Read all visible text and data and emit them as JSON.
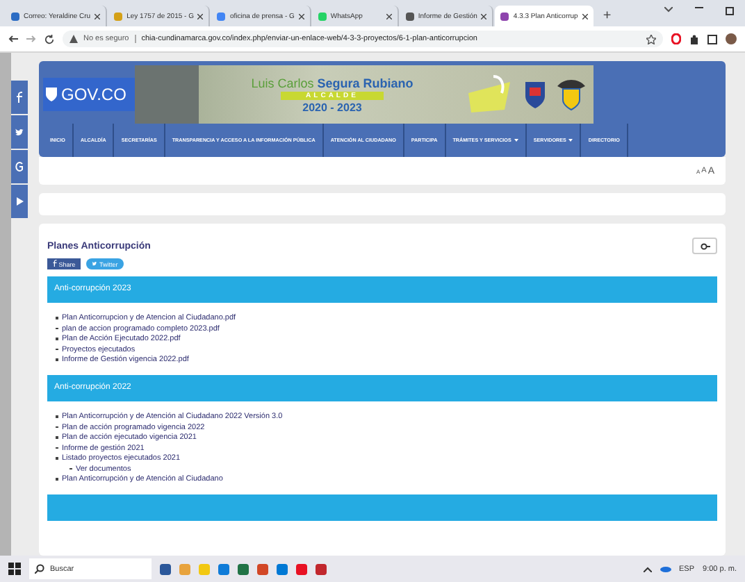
{
  "browser": {
    "tabs": [
      {
        "label": "Correo: Yeraldine Cru",
        "selected": false,
        "color": "#2b6cc4"
      },
      {
        "label": "Ley 1757 de 2015 - G",
        "selected": false,
        "color": "#d4a017"
      },
      {
        "label": "oficina de prensa - G",
        "selected": false,
        "color": "#4285f4"
      },
      {
        "label": "WhatsApp",
        "selected": false,
        "color": "#25d366"
      },
      {
        "label": "Informe de Gestión",
        "selected": false,
        "color": "#555555"
      },
      {
        "label": "4.3.3 Plan Anticorrup",
        "selected": true,
        "color": "#8e44ad"
      }
    ],
    "new_tab": "+",
    "security": "No es seguro",
    "url": "chia-cundinamarca.gov.co/index.php/enviar-un-enlace-web/4-3-3-proyectos/6-1-plan-anticorrupcion"
  },
  "header": {
    "logo": "GOV.CO",
    "banner": {
      "first_name": "Luis Carlos",
      "last_name": "Segura Rubiano",
      "role": "ALCALDE",
      "years": "2020 - 2023"
    },
    "nav": [
      {
        "label": "INICIO",
        "dropdown": false
      },
      {
        "label": "ALCALDÍA",
        "dropdown": false
      },
      {
        "label": "SECRETARÍAS",
        "dropdown": false
      },
      {
        "label": "TRANSPARENCIA Y ACCESO A LA INFORMACIÓN PÚBLICA",
        "dropdown": false
      },
      {
        "label": "ATENCIÓN AL CIUDADANO",
        "dropdown": false
      },
      {
        "label": "PARTICIPA",
        "dropdown": false
      },
      {
        "label": "TRÁMITES Y SERVICIOS",
        "dropdown": true
      },
      {
        "label": "SERVIDORES",
        "dropdown": true
      },
      {
        "label": "DIRECTORIO",
        "dropdown": false
      }
    ]
  },
  "font_sizes": [
    "A",
    "A",
    "A"
  ],
  "content": {
    "title": "Planes Anticorrupción",
    "share": [
      {
        "kind": "facebook",
        "label": "Share"
      },
      {
        "kind": "twitter",
        "label": "Twitter"
      }
    ],
    "sections": [
      {
        "title": "Anti-corrupción 2023",
        "items": [
          {
            "text": "Plan Anticorrupcion y de Atencion al Ciudadano.pdf"
          },
          {
            "text": "plan de accion programado completo 2023.pdf"
          },
          {
            "text": "Plan de Acción Ejecutado 2022.pdf"
          },
          {
            "text": "Proyectos ejecutados"
          },
          {
            "text": "Informe de Gestión vigencia 2022.pdf"
          }
        ]
      },
      {
        "title": "Anti-corrupción 2022",
        "items": [
          {
            "text": "Plan Anticorrupción y de Atención al Ciudadano 2022 Versión 3.0"
          },
          {
            "text": "Plan de acción programado vigencia 2022"
          },
          {
            "text": "Plan de acción ejecutado vigencia 2021"
          },
          {
            "text": "Informe de gestión 2021"
          },
          {
            "text": "Listado proyectos ejecutados 2021",
            "children": [
              {
                "text": "Ver documentos"
              }
            ]
          },
          {
            "text": "Plan Anticorrupción y de Atención al Ciudadano"
          }
        ]
      }
    ]
  },
  "taskbar": {
    "search": "Buscar",
    "language": "ESP",
    "time": "9:00 p. m."
  }
}
